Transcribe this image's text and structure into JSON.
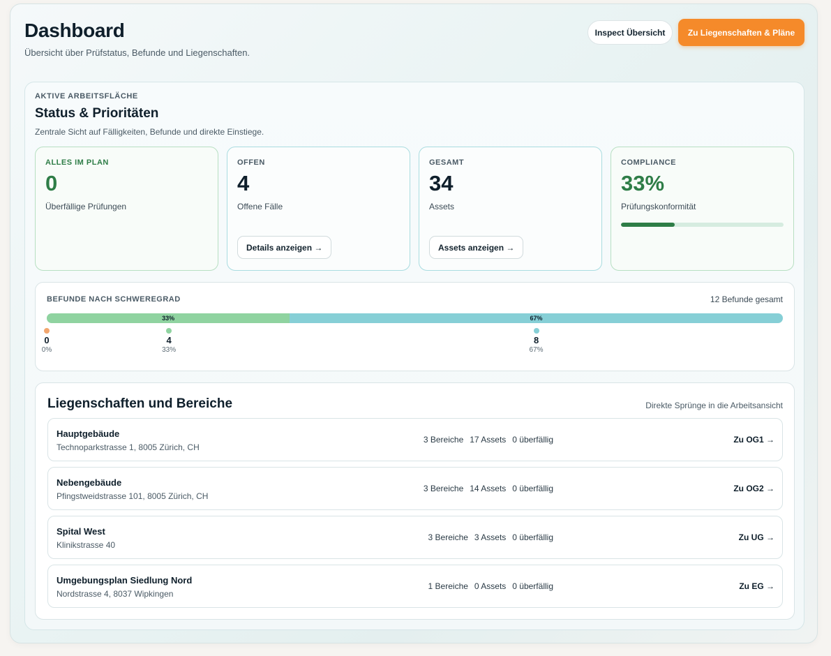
{
  "header": {
    "title": "Dashboard",
    "subtitle": "Übersicht über Prüfstatus, Befunde und Liegenschaften.",
    "inspect_button": "Inspect Übersicht",
    "primary_button": "Zu Liegenschaften & Pläne"
  },
  "workspace": {
    "eyebrow": "AKTIVE ARBEITSFLÄCHE",
    "title": "Status & Prioritäten",
    "description": "Zentrale Sicht auf Fälligkeiten, Befunde und direkte Einstiege."
  },
  "kpis": [
    {
      "label": "ALLES IM PLAN",
      "value": "0",
      "sub": "Überfällige Prüfungen"
    },
    {
      "label": "OFFEN",
      "value": "4",
      "sub": "Offene Fälle",
      "button": "Details anzeigen →"
    },
    {
      "label": "GESAMT",
      "value": "34",
      "sub": "Assets",
      "button": "Assets anzeigen →"
    },
    {
      "label": "COMPLIANCE",
      "value": "33%",
      "sub": "Prüfungskonformität",
      "progress": 0.33
    }
  ],
  "colors": {
    "accent": "#f58a2a",
    "green": "#2e7d47",
    "sev_orange": "#f2a66e",
    "sev_green": "#8fd3a0",
    "sev_teal": "#86cfd6"
  },
  "severity": {
    "title": "BEFUNDE NACH SCHWEREGRAD",
    "total": "12 Befunde gesamt",
    "segments": [
      {
        "label": "33%",
        "fraction": 0.33,
        "color": "#8fd3a0"
      },
      {
        "label": "67%",
        "fraction": 0.67,
        "color": "#86cfd6"
      }
    ],
    "markers": [
      {
        "count": "0",
        "pct": "0%",
        "position": 0.0,
        "color": "#f2a66e"
      },
      {
        "count": "4",
        "pct": "33%",
        "position": 0.166,
        "color": "#8fd3a0"
      },
      {
        "count": "8",
        "pct": "67%",
        "position": 0.665,
        "color": "#86cfd6"
      }
    ]
  },
  "properties": {
    "title": "Liegenschaften und Bereiche",
    "hint": "Direkte Sprünge in die Arbeitsansicht",
    "items": [
      {
        "name": "Hauptgebäude",
        "address": "Technoparkstrasse 1, 8005 Zürich, CH",
        "areas": "3 Bereiche",
        "assets": "17 Assets",
        "overdue": "0 überfällig",
        "link": "Zu OG1 →"
      },
      {
        "name": "Nebengebäude",
        "address": "Pfingstweidstrasse 101, 8005 Zürich, CH",
        "areas": "3 Bereiche",
        "assets": "14 Assets",
        "overdue": "0 überfällig",
        "link": "Zu OG2 →"
      },
      {
        "name": "Spital West",
        "address": "Klinikstrasse 40",
        "areas": "3 Bereiche",
        "assets": "3 Assets",
        "overdue": "0 überfällig",
        "link": "Zu UG →"
      },
      {
        "name": "Umgebungsplan Siedlung Nord",
        "address": "Nordstrasse 4, 8037 Wipkingen",
        "areas": "1 Bereiche",
        "assets": "0 Assets",
        "overdue": "0 überfällig",
        "link": "Zu EG →"
      }
    ]
  }
}
